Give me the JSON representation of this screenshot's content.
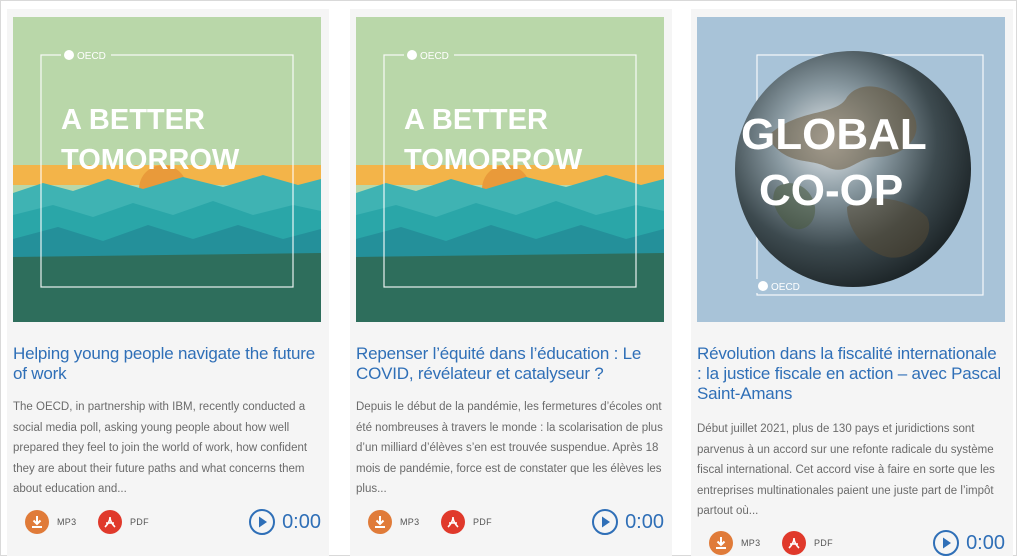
{
  "cards": [
    {
      "art": {
        "brand": "OECD",
        "line1": "A BETTER",
        "line2": "TOMORROW"
      },
      "title": "Helping young people navigate the future of work",
      "description": "The OECD, in partnership with IBM, recently conducted a social media poll, asking young people about how well prepared they feel to join the world of work, how confident they are about their future paths and what concerns them about education and...",
      "mp3_label": "MP3",
      "pdf_label": "PDF",
      "time": "0:00"
    },
    {
      "art": {
        "brand": "OECD",
        "line1": "A BETTER",
        "line2": "TOMORROW"
      },
      "title": "Repenser l’équité dans l’éducation : Le COVID, révélateur et catalyseur ?",
      "description": "Depuis le début de la pandémie, les fermetures d’écoles ont été nombreuses à travers le monde : la scolarisation de plus d’un milliard d’élèves s’en est trouvée suspendue. Après 18 mois de pandémie, force est de constater que les élèves les plus...",
      "mp3_label": "MP3",
      "pdf_label": "PDF",
      "time": "0:00"
    },
    {
      "art": {
        "brand": "OECD",
        "line1": "GLOBAL",
        "line2": "CO-OP"
      },
      "title": "Révolution dans la fiscalité internationale : la justice fiscale en action – avec Pascal Saint-Amans",
      "description": "Début juillet 2021, plus de 130 pays et juridictions sont parvenus à un accord sur une refonte radicale du système fiscal international. Cet accord vise à faire en sorte que les entreprises multinationales paient une juste part de l’impôt partout où...",
      "mp3_label": "MP3",
      "pdf_label": "PDF",
      "time": "0:00"
    }
  ],
  "colors": {
    "title_blue": "#2f6fb7",
    "mp3_orange": "#e07b39",
    "pdf_red": "#e0392b",
    "sky_green": "#b9d7a9",
    "sun_yellow": "#f3b449",
    "sea_teal": "#2aa6a8",
    "deep_green": "#2e6e5c",
    "globe_bg": "#a8c3d8"
  },
  "icons": [
    "download-icon",
    "pdf-icon",
    "play-icon",
    "oecd-logo"
  ]
}
